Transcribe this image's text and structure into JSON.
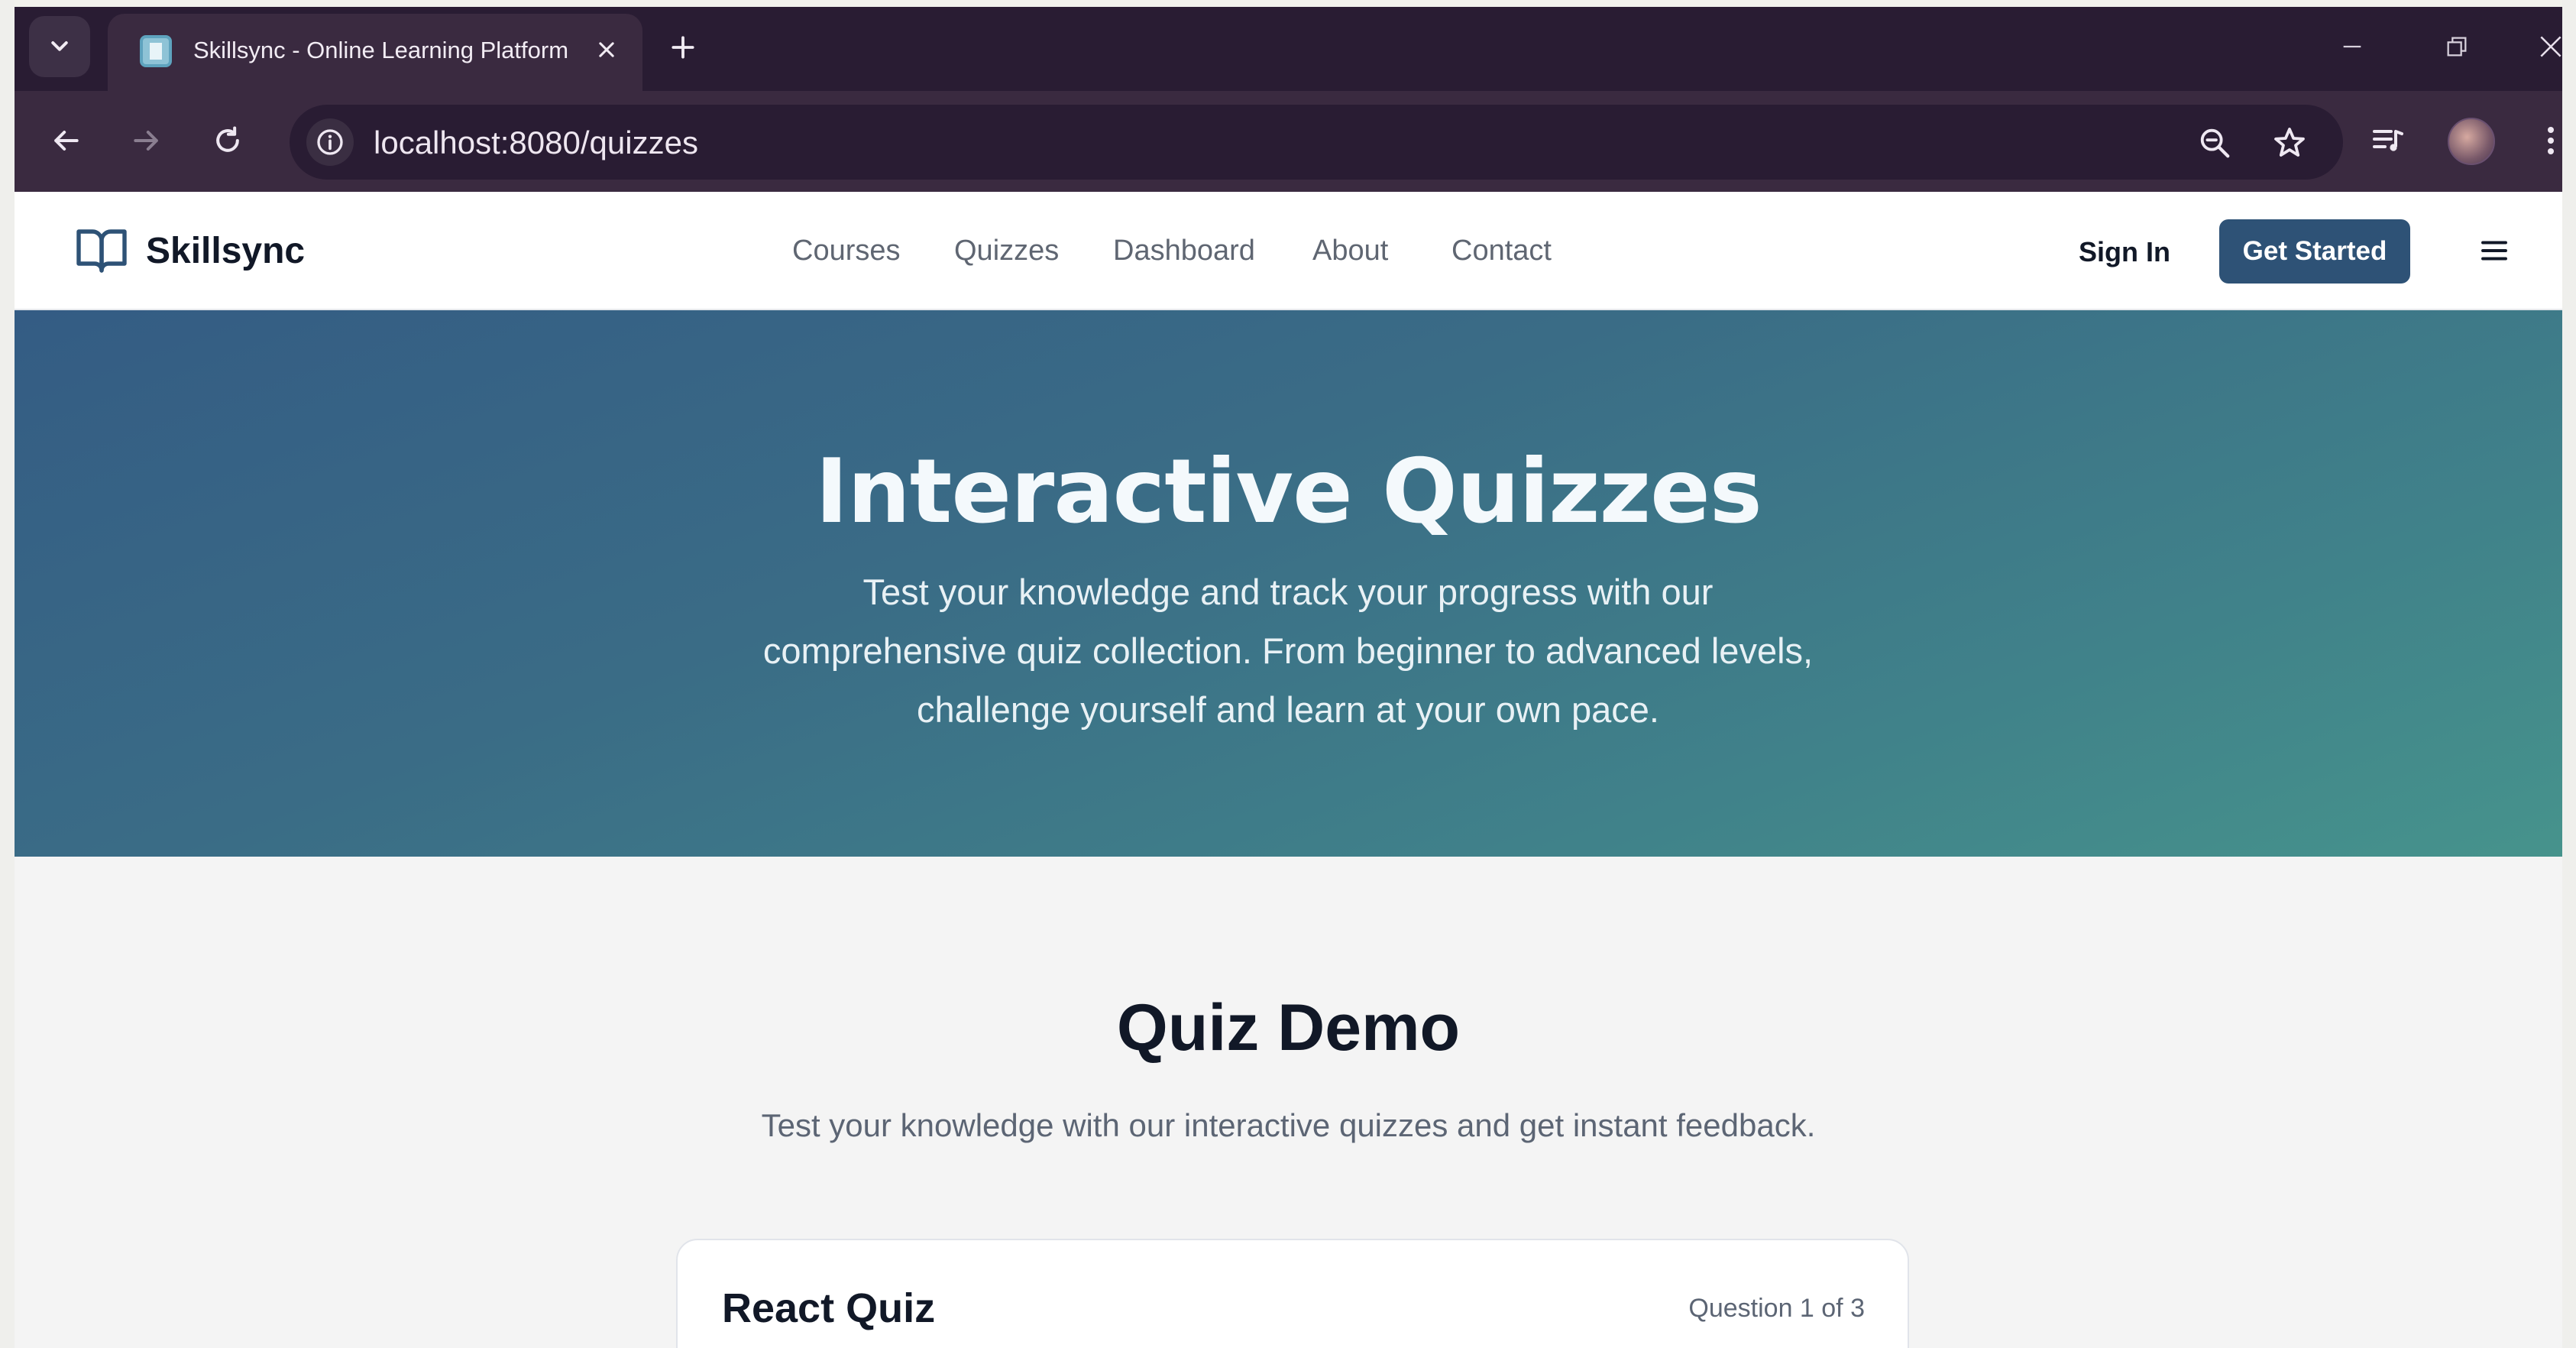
{
  "browser": {
    "tab": {
      "title": "Skillsync - Online Learning Platform"
    },
    "address_bar": {
      "url": "localhost:8080/quizzes"
    }
  },
  "header": {
    "brand": "Skillsync",
    "nav": [
      "Courses",
      "Quizzes",
      "Dashboard",
      "About",
      "Contact"
    ],
    "sign_in": "Sign In",
    "get_started": "Get Started"
  },
  "hero": {
    "title": "Interactive Quizzes",
    "subtitle_lines": [
      "Test your knowledge and track your progress with our",
      "comprehensive quiz collection. From beginner to advanced levels,",
      "challenge yourself and learn at your own pace."
    ]
  },
  "section": {
    "title": "Quiz Demo",
    "subtitle": "Test your knowledge with our interactive quizzes and get instant feedback."
  },
  "quiz": {
    "title": "React Quiz",
    "progress": "Question 1 of 3"
  },
  "colors": {
    "chrome_dark": "#291c33",
    "chrome_toolbar": "#3a2a40",
    "brand_button": "#2e5276",
    "hero_gradient_start": "#345c84",
    "hero_gradient_end": "#46938c"
  }
}
